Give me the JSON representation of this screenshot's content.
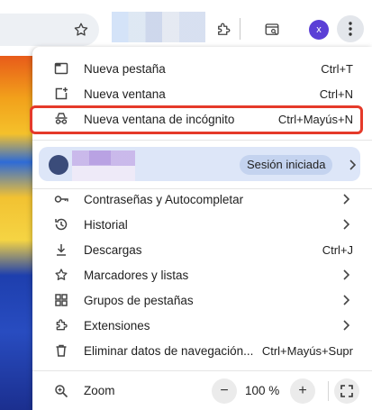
{
  "toolbar": {
    "avatar_letter": "x"
  },
  "menu": {
    "items": [
      {
        "label": "Nueva pestaña",
        "shortcut": "Ctrl+T",
        "icon": "new-tab-icon"
      },
      {
        "label": "Nueva ventana",
        "shortcut": "Ctrl+N",
        "icon": "new-window-icon"
      },
      {
        "label": "Nueva ventana de incógnito",
        "shortcut": "Ctrl+Mayús+N",
        "icon": "incognito-icon"
      }
    ],
    "profile": {
      "status": "Sesión iniciada"
    },
    "items2": [
      {
        "label": "Contraseñas y Autocompletar",
        "shortcut": "",
        "icon": "key-icon",
        "submenu": true
      },
      {
        "label": "Historial",
        "shortcut": "",
        "icon": "history-icon",
        "submenu": true
      },
      {
        "label": "Descargas",
        "shortcut": "Ctrl+J",
        "icon": "download-icon",
        "submenu": false
      },
      {
        "label": "Marcadores y listas",
        "shortcut": "",
        "icon": "star-icon",
        "submenu": true
      },
      {
        "label": "Grupos de pestañas",
        "shortcut": "",
        "icon": "tab-groups-icon",
        "submenu": true
      },
      {
        "label": "Extensiones",
        "shortcut": "",
        "icon": "puzzle-icon",
        "submenu": true
      },
      {
        "label": "Eliminar datos de navegación...",
        "shortcut": "Ctrl+Mayús+Supr",
        "icon": "trash-icon",
        "submenu": false
      }
    ],
    "zoom": {
      "label": "Zoom",
      "value": "100 %",
      "minus": "−",
      "plus": "+"
    }
  },
  "colors": {
    "highlight": "#e53a2a",
    "profile_bg": "#dde6f8",
    "avatar": "#5b3fd6"
  }
}
